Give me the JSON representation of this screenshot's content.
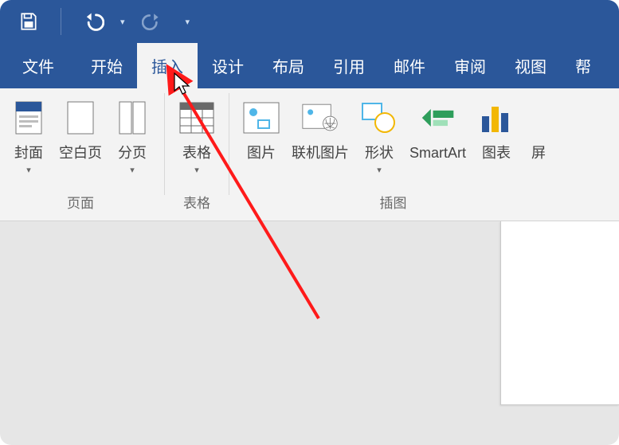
{
  "qat": {
    "save_tip": "保存",
    "undo_tip": "撤销",
    "redo_tip": "恢复"
  },
  "tabs": {
    "file": "文件",
    "home": "开始",
    "insert": "插入",
    "design": "设计",
    "layout": "布局",
    "references": "引用",
    "mailings": "邮件",
    "review": "审阅",
    "view": "视图",
    "help_partial": "帮"
  },
  "ribbon": {
    "pages_group": "页面",
    "tables_group": "表格",
    "illustrations_group": "插图",
    "cover_page": "封面",
    "blank_page": "空白页",
    "page_break": "分页",
    "table": "表格",
    "picture": "图片",
    "online_pic": "联机图片",
    "shapes": "形状",
    "smartart": "SmartArt",
    "chart": "图表",
    "screenshot_partial": "屏"
  }
}
